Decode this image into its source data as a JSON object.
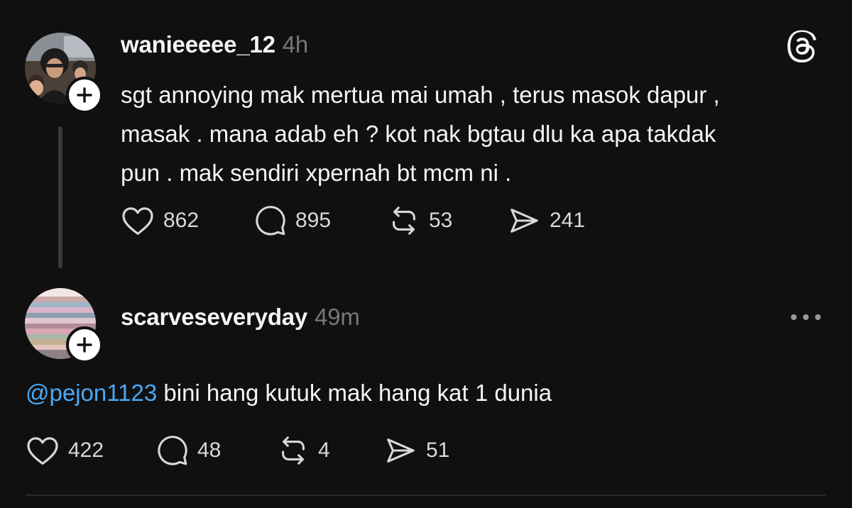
{
  "post": {
    "username": "wanieeeee_12",
    "time": "4h",
    "lines": [
      "sgt annoying mak mertua mai umah , terus masok dapur ,",
      "masak . mana adab eh ? kot nak bgtau dlu ka apa takdak",
      "pun . mak sendiri xpernah bt mcm ni ."
    ],
    "likes": "862",
    "replies": "895",
    "reposts": "53",
    "shares": "241"
  },
  "reply": {
    "username": "scarveseveryday",
    "time": "49m",
    "mention": "@pejon1123",
    "text": " bini hang kutuk mak hang kat 1 dunia",
    "likes": "422",
    "replies": "48",
    "reposts": "4",
    "shares": "51"
  },
  "icons": {
    "logo": "threads-logo-icon",
    "more": "more-horizontal-icon",
    "like": "heart-icon",
    "reply": "comment-icon",
    "repost": "repost-icon",
    "share": "send-icon",
    "follow": "plus-icon"
  },
  "colors": {
    "background": "#101010",
    "text": "#f3f5f7",
    "muted": "#777777",
    "mention": "#4ba8f5"
  }
}
